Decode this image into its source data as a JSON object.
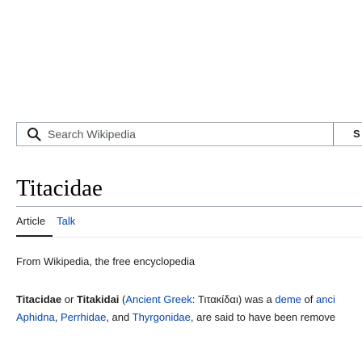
{
  "search": {
    "placeholder": "Search Wikipedia",
    "button_label": "S"
  },
  "icons": {
    "search": "search-icon"
  },
  "colors": {
    "link": "#0645ad",
    "text": "#202122",
    "border": "#a2a9b1"
  },
  "article": {
    "title": "Titacidae",
    "tabs": [
      {
        "label": "Article",
        "active": true
      },
      {
        "label": "Talk",
        "active": false
      }
    ],
    "tagline": "From Wikipedia, the free encyclopedia",
    "lead": {
      "line1": {
        "bold1": "Titacidae",
        "or": " or ",
        "bold2": "Titakidai",
        "paren_open": " (",
        "lang_link": "Ancient Greek",
        "greek": ": Τιτακίδαι",
        "paren_close": ")",
        "rest": " was a ",
        "deme_link": "deme",
        "of": " of ",
        "anci_link": "anci"
      },
      "line2": {
        "aphidna_link": "Aphidna",
        "sep1": ", ",
        "perrhidae_link": "Perrhidae",
        "sep2": ", and ",
        "thyrgonidae_link": "Thyrgonidae",
        "rest": ", are said to have been remove"
      }
    }
  }
}
